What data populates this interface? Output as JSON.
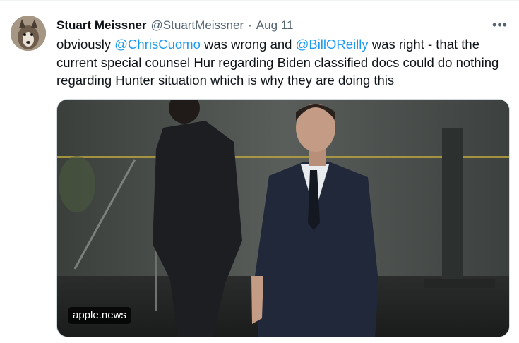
{
  "tweet": {
    "author_name": "Stuart Meissner",
    "author_handle": "@StuartMeissner",
    "separator": "·",
    "date": "Aug 11",
    "more_label": "•••",
    "text": {
      "part1": "obviously ",
      "mention1": "@ChrisCuomo",
      "part2": " was wrong and ",
      "mention2": "@BillOReilly",
      "part3": " was right - that the current special counsel Hur regarding Biden classified docs could do nothing regarding Hunter situation which is why they are doing this"
    },
    "media": {
      "source_label": "apple.news"
    }
  },
  "colors": {
    "link": "#1d9bf0",
    "secondary_text": "#536471",
    "primary_text": "#0f1419"
  }
}
